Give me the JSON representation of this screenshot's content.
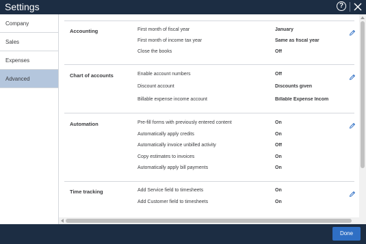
{
  "window": {
    "title": "Settings",
    "help_symbol": "?",
    "colors": {
      "titlebar": "#1c2d43",
      "active_tab": "#b4c6dd",
      "done_button": "#2f6fc4"
    }
  },
  "sidebar": {
    "items": [
      {
        "label": "Company",
        "active": false
      },
      {
        "label": "Sales",
        "active": false
      },
      {
        "label": "Expenses",
        "active": false
      },
      {
        "label": "Advanced",
        "active": true
      }
    ]
  },
  "sections": [
    {
      "title": "Accounting",
      "rows": [
        {
          "label": "First month of fiscal year",
          "value": "January"
        },
        {
          "label": "First month of income tax year",
          "value": "Same as fiscal year"
        },
        {
          "label": "Close the books",
          "value": "Off"
        }
      ]
    },
    {
      "title": "Chart of accounts",
      "rows": [
        {
          "label": "Enable account numbers",
          "value": "Off"
        },
        {
          "label": "Discount account",
          "value": "Discounts given"
        },
        {
          "label": "Billable expense income account",
          "value": "Billable Expense Income"
        }
      ]
    },
    {
      "title": "Automation",
      "rows": [
        {
          "label": "Pre-fill forms with previously entered content",
          "value": "On"
        },
        {
          "label": "Automatically apply credits",
          "value": "On"
        },
        {
          "label": "Automatically invoice unbilled activity",
          "value": "Off"
        },
        {
          "label": "Copy estimates to invoices",
          "value": "On"
        },
        {
          "label": "Automatically apply bill payments",
          "value": "On"
        }
      ]
    },
    {
      "title": "Time tracking",
      "rows": [
        {
          "label": "Add Service field to timesheets",
          "value": "On"
        },
        {
          "label": "Add Customer field to timesheets",
          "value": "On"
        }
      ]
    }
  ],
  "footer": {
    "done_label": "Done"
  }
}
